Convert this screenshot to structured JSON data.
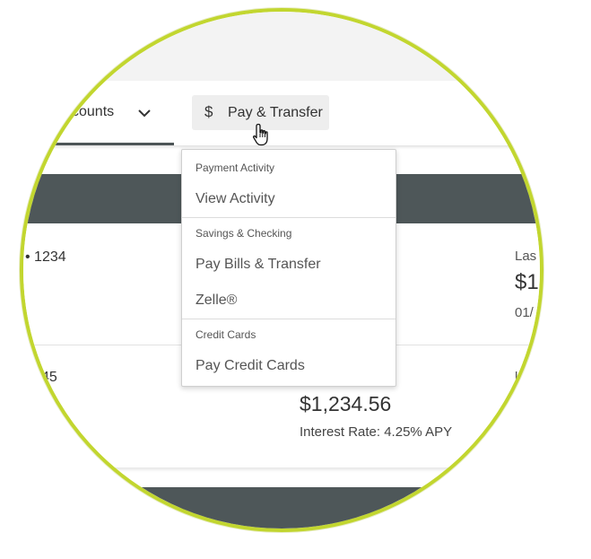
{
  "nav": {
    "accounts_label": "ccounts",
    "pay_transfer_label": "Pay & Transfer",
    "pay_transfer_icon": "$"
  },
  "dropdown": {
    "sections": [
      {
        "heading": "Payment Activity",
        "items": [
          "View Activity"
        ]
      },
      {
        "heading": "Savings & Checking",
        "items": [
          "Pay Bills & Transfer",
          "Zelle®"
        ]
      },
      {
        "heading": "Credit Cards",
        "items": [
          "Pay Credit Cards"
        ]
      }
    ]
  },
  "accounts": {
    "row1": {
      "number": "• 1234",
      "right_label": "Las",
      "right_amount": "$1",
      "right_date": "01/"
    },
    "row2": {
      "number": "45",
      "right_label": "l",
      "balance": "$1,234.56",
      "interest": "Interest Rate: 4.25% APY"
    }
  },
  "colors": {
    "ring": "#c2d62f",
    "band": "#4e5759",
    "button_bg": "#eeeeee"
  }
}
